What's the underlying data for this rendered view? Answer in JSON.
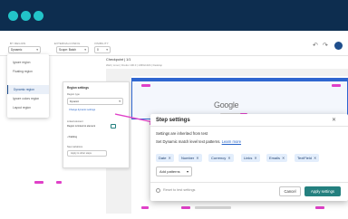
{
  "toolbar": {
    "col1_label": "BY REGION",
    "col1_value": "Dynamic",
    "col2_label": "EXTERNALCONFIG",
    "col2_value": "Scope: Batch",
    "col3_label": "VISIBILITY",
    "col3_value": "0"
  },
  "dropdown": {
    "items": [
      "Ignore region",
      "Floating region",
      "",
      "Dynamic region",
      "Ignore colors region",
      "Layout region"
    ]
  },
  "region_settings": {
    "title": "Region settings",
    "type_label": "Region type",
    "type_value": "Dynamic",
    "link": "Change dynamic settings",
    "linked_label": "Linked element",
    "linked_text": "Region is linked to element",
    "padding_label": "Padding",
    "new_variations_label": "New variations",
    "apply_btn": "Apply to other steps"
  },
  "checkpoint": {
    "title": "Checkpoint | 1/1",
    "subtitle": "Web | Linux | Firefox 100.0 | 1366x1024 | Desktop"
  },
  "page": {
    "logo": "Google"
  },
  "dialog": {
    "title": "Step settings",
    "line1": "Settings are inherited from test",
    "line2": "Set Dynamic match level text patterns.",
    "learn_more": "Learn more",
    "chips": [
      "Date",
      "Number",
      "Currency",
      "Links",
      "Emails",
      "TextField"
    ],
    "add_patterns": "Add patterns",
    "reset": "Reset to test settings",
    "cancel": "Cancel",
    "apply": "Apply settings"
  },
  "colors": {
    "appbar": "#0d2d4f",
    "accent": "#24807f",
    "chip": "#e3eefc",
    "highlight": "#e040c8",
    "region": "#2f66d0"
  }
}
